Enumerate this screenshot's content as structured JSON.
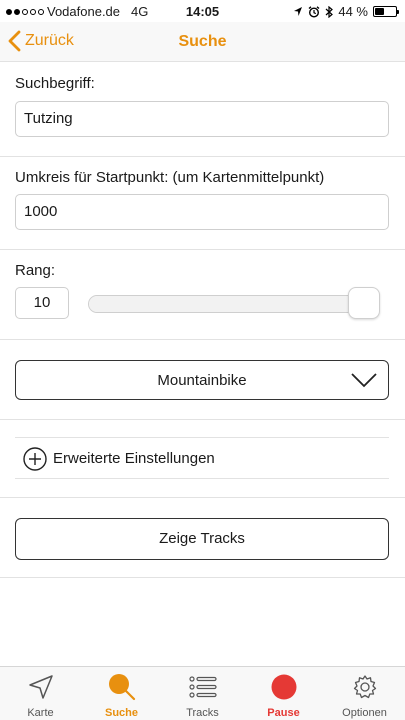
{
  "status": {
    "carrier": "Vodafone.de",
    "network": "4G",
    "time": "14:05",
    "battery_text": "44 %",
    "battery_level": 0.44
  },
  "nav": {
    "back_label": "Zurück",
    "title": "Suche"
  },
  "search": {
    "label": "Suchbegriff:",
    "value": "Tutzing"
  },
  "radius": {
    "label": "Umkreis für Startpunkt: (um Kartenmittelpunkt)",
    "value": "1000"
  },
  "rank": {
    "label": "Rang:",
    "value": "10",
    "slider_fraction": 1.0
  },
  "category": {
    "selected": "Mountainbike"
  },
  "advanced": {
    "label": "Erweiterte Einstellungen"
  },
  "actions": {
    "show_tracks": "Zeige Tracks"
  },
  "tabs": [
    {
      "label": "Karte",
      "icon": "location-arrow-icon"
    },
    {
      "label": "Suche",
      "icon": "search-icon"
    },
    {
      "label": "Tracks",
      "icon": "list-icon"
    },
    {
      "label": "Pause",
      "icon": "record-dot-icon"
    },
    {
      "label": "Optionen",
      "icon": "gear-icon"
    }
  ],
  "colors": {
    "accent": "#e8900f",
    "pause": "#e53935"
  }
}
